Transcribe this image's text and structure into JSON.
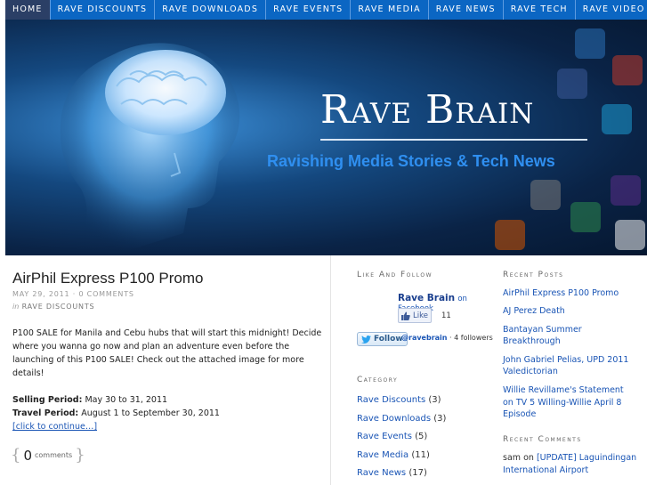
{
  "nav": {
    "items": [
      "Home",
      "Rave Discounts",
      "Rave Downloads",
      "Rave Events",
      "Rave Media",
      "Rave News",
      "Rave Tech",
      "Rave Video"
    ]
  },
  "header": {
    "title": "Rave Brain",
    "tagline": "Ravishing Media Stories & Tech News"
  },
  "post": {
    "title": "AirPhil Express P100 Promo",
    "date": "May 29, 2011",
    "comments_link": "0 Comments",
    "in_label": "in",
    "category": "Rave Discounts",
    "paragraph": "P100 SALE for Manila and Cebu hubs that will start this midnight! Decide where you wanna go now and plan an adventure even before the launching of this P100 SALE! Check out the attached image for more details!",
    "selling_label": "Selling Period:",
    "selling_value": "May 30 to 31, 2011",
    "travel_label": "Travel Period:",
    "travel_value": "August 1 to September 30, 2011",
    "continue": "[click to continue…]",
    "comment_count": "0",
    "comment_label": "comments"
  },
  "like_follow": {
    "heading": "Like and Follow",
    "fb_name": "Rave Brain",
    "fb_on": "on Facebook",
    "like_label": "Like",
    "like_count": "11",
    "follow_label": "Follow",
    "twitter_handle": "@ravebrain",
    "followers": "· 4 followers"
  },
  "categories": {
    "heading": "Category",
    "items": [
      {
        "label": "Rave Discounts",
        "count": "(3)"
      },
      {
        "label": "Rave Downloads",
        "count": "(3)"
      },
      {
        "label": "Rave Events",
        "count": "(5)"
      },
      {
        "label": "Rave Media",
        "count": "(11)"
      },
      {
        "label": "Rave News",
        "count": "(17)"
      }
    ]
  },
  "recent_posts": {
    "heading": "Recent Posts",
    "items": [
      "AirPhil Express P100 Promo",
      "AJ Perez Death",
      "Bantayan Summer Breakthrough",
      "John Gabriel Pelias, UPD 2011 Valedictorian",
      "Willie Revillame's Statement on TV 5 Willing-Willie April 8 Episode"
    ]
  },
  "recent_comments": {
    "heading": "Recent Comments",
    "author": "sam",
    "on": "on",
    "post": "[UPDATE] Laguindingan International Airport"
  },
  "colors": {
    "nav_bg": "#0b66c3",
    "nav_active": "#2b3f66",
    "link": "#1a55b5",
    "tagline": "#2f8ff0"
  }
}
